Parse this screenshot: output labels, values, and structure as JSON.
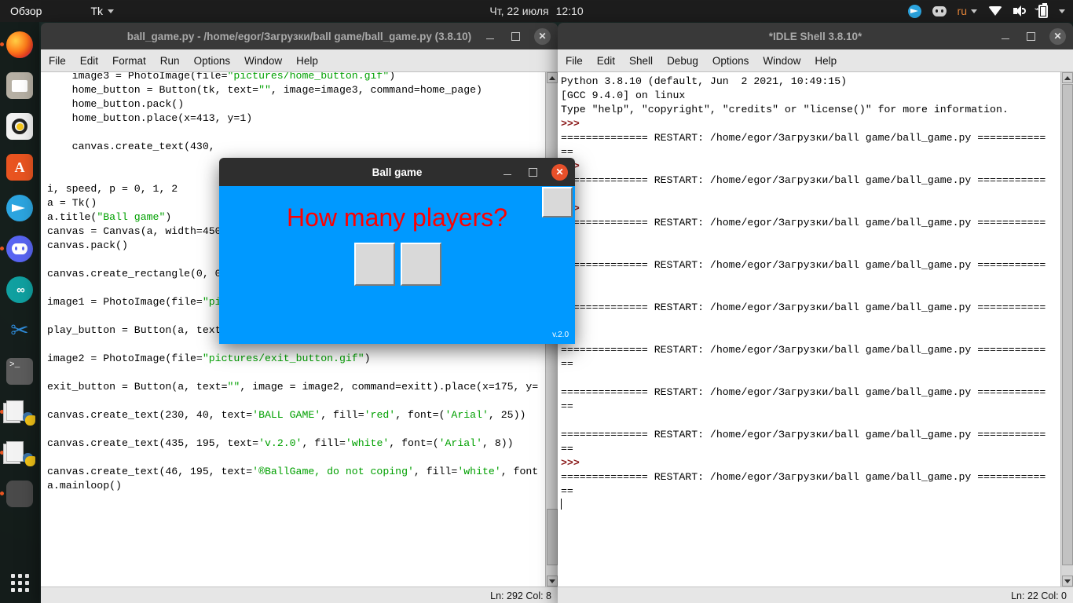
{
  "topbar": {
    "activities": "Обзор",
    "app_name": "Tk",
    "date": "Чт, 22 июля",
    "time": "12:10",
    "language": "ru",
    "icons": [
      "telegram-icon",
      "discord-icon",
      "wifi-icon",
      "volume-icon",
      "battery-icon",
      "chevron-down-icon"
    ]
  },
  "dock": {
    "items": [
      {
        "name": "firefox",
        "running": true
      },
      {
        "name": "files",
        "running": false
      },
      {
        "name": "rhythmbox",
        "running": false
      },
      {
        "name": "ubuntu-software",
        "running": false
      },
      {
        "name": "telegram",
        "running": false
      },
      {
        "name": "discord",
        "running": true
      },
      {
        "name": "arduino",
        "running": false
      },
      {
        "name": "vscode",
        "running": false
      },
      {
        "name": "terminal",
        "running": false
      },
      {
        "name": "idle-editor",
        "running": true
      },
      {
        "name": "idle-shell",
        "running": true
      },
      {
        "name": "tk-window",
        "running": true
      }
    ],
    "show_apps": "show-applications"
  },
  "editor_window": {
    "title": "ball_game.py - /home/egor/Загрузки/ball game/ball_game.py (3.8.10)",
    "menus": [
      "File",
      "Edit",
      "Format",
      "Run",
      "Options",
      "Window",
      "Help"
    ],
    "status": "Ln: 292  Col: 8",
    "code": [
      {
        "t": "plain",
        "v": "    image3 = PhotoImage(file="
      },
      {
        "t": "str",
        "v": "\"pictures/home_button.gif\""
      },
      {
        "t": "plain",
        "v": ")\n    home_button = Button(tk, text="
      },
      {
        "t": "str",
        "v": "\"\""
      },
      {
        "t": "plain",
        "v": ", image=image3, command=home_page)\n    home_button.pack()\n    home_button.place(x=413, y=1)\n\n    canvas.create_text(430, \n\n\ni, speed, p = 0, 1, 2\na = Tk()\na.title("
      },
      {
        "t": "str",
        "v": "\"Ball game\""
      },
      {
        "t": "plain",
        "v": ")\ncanvas = Canvas(a, width=450\ncanvas.pack()\n\ncanvas.create_rectangle(0, 0\n\nimage1 = PhotoImage(file="
      },
      {
        "t": "str",
        "v": "\"pi"
      },
      {
        "t": "plain",
        "v": "\n\nplay_button = Button(a, text\n\nimage2 = PhotoImage(file="
      },
      {
        "t": "str",
        "v": "\"pictures/exit_button.gif\""
      },
      {
        "t": "plain",
        "v": ")\n\nexit_button = Button(a, text="
      },
      {
        "t": "str",
        "v": "\"\""
      },
      {
        "t": "plain",
        "v": ", image = image2, command=exitt).place(x=175, y=\n\ncanvas.create_text(230, 40, text="
      },
      {
        "t": "str",
        "v": "'BALL GAME'"
      },
      {
        "t": "plain",
        "v": ", fill="
      },
      {
        "t": "str",
        "v": "'red'"
      },
      {
        "t": "plain",
        "v": ", font=("
      },
      {
        "t": "str",
        "v": "'Arial'"
      },
      {
        "t": "plain",
        "v": ", 25))\n\ncanvas.create_text(435, 195, text="
      },
      {
        "t": "str",
        "v": "'v.2.0'"
      },
      {
        "t": "plain",
        "v": ", fill="
      },
      {
        "t": "str",
        "v": "'white'"
      },
      {
        "t": "plain",
        "v": ", font=("
      },
      {
        "t": "str",
        "v": "'Arial'"
      },
      {
        "t": "plain",
        "v": ", 8))\n\ncanvas.create_text(46, 195, text="
      },
      {
        "t": "str",
        "v": "'®BallGame, do not coping'"
      },
      {
        "t": "plain",
        "v": ", fill="
      },
      {
        "t": "str",
        "v": "'white'"
      },
      {
        "t": "plain",
        "v": ", font\na.mainloop()"
      }
    ]
  },
  "shell_window": {
    "title": "*IDLE Shell 3.8.10*",
    "menus": [
      "File",
      "Edit",
      "Shell",
      "Debug",
      "Options",
      "Window",
      "Help"
    ],
    "status": "Ln: 22  Col: 0",
    "banner": [
      "Python 3.8.10 (default, Jun  2 2021, 10:49:15)",
      "[GCC 9.4.0] on linux",
      "Type \"help\", \"copyright\", \"credits\" or \"license()\" for more information."
    ],
    "prompt": ">>>",
    "restart_line": "============== RESTART: /home/egor/Загрузки/ball game/ball_game.py ===========",
    "restart_wrap": "==",
    "restart_count": 9
  },
  "game_dialog": {
    "title": "Ball game",
    "question": "How many players?",
    "version": "v.2.0",
    "buttons": [
      "players-one-button",
      "players-two-button",
      "home-button"
    ],
    "canvas_color": "#0099ff",
    "text_color": "#ff0000"
  }
}
